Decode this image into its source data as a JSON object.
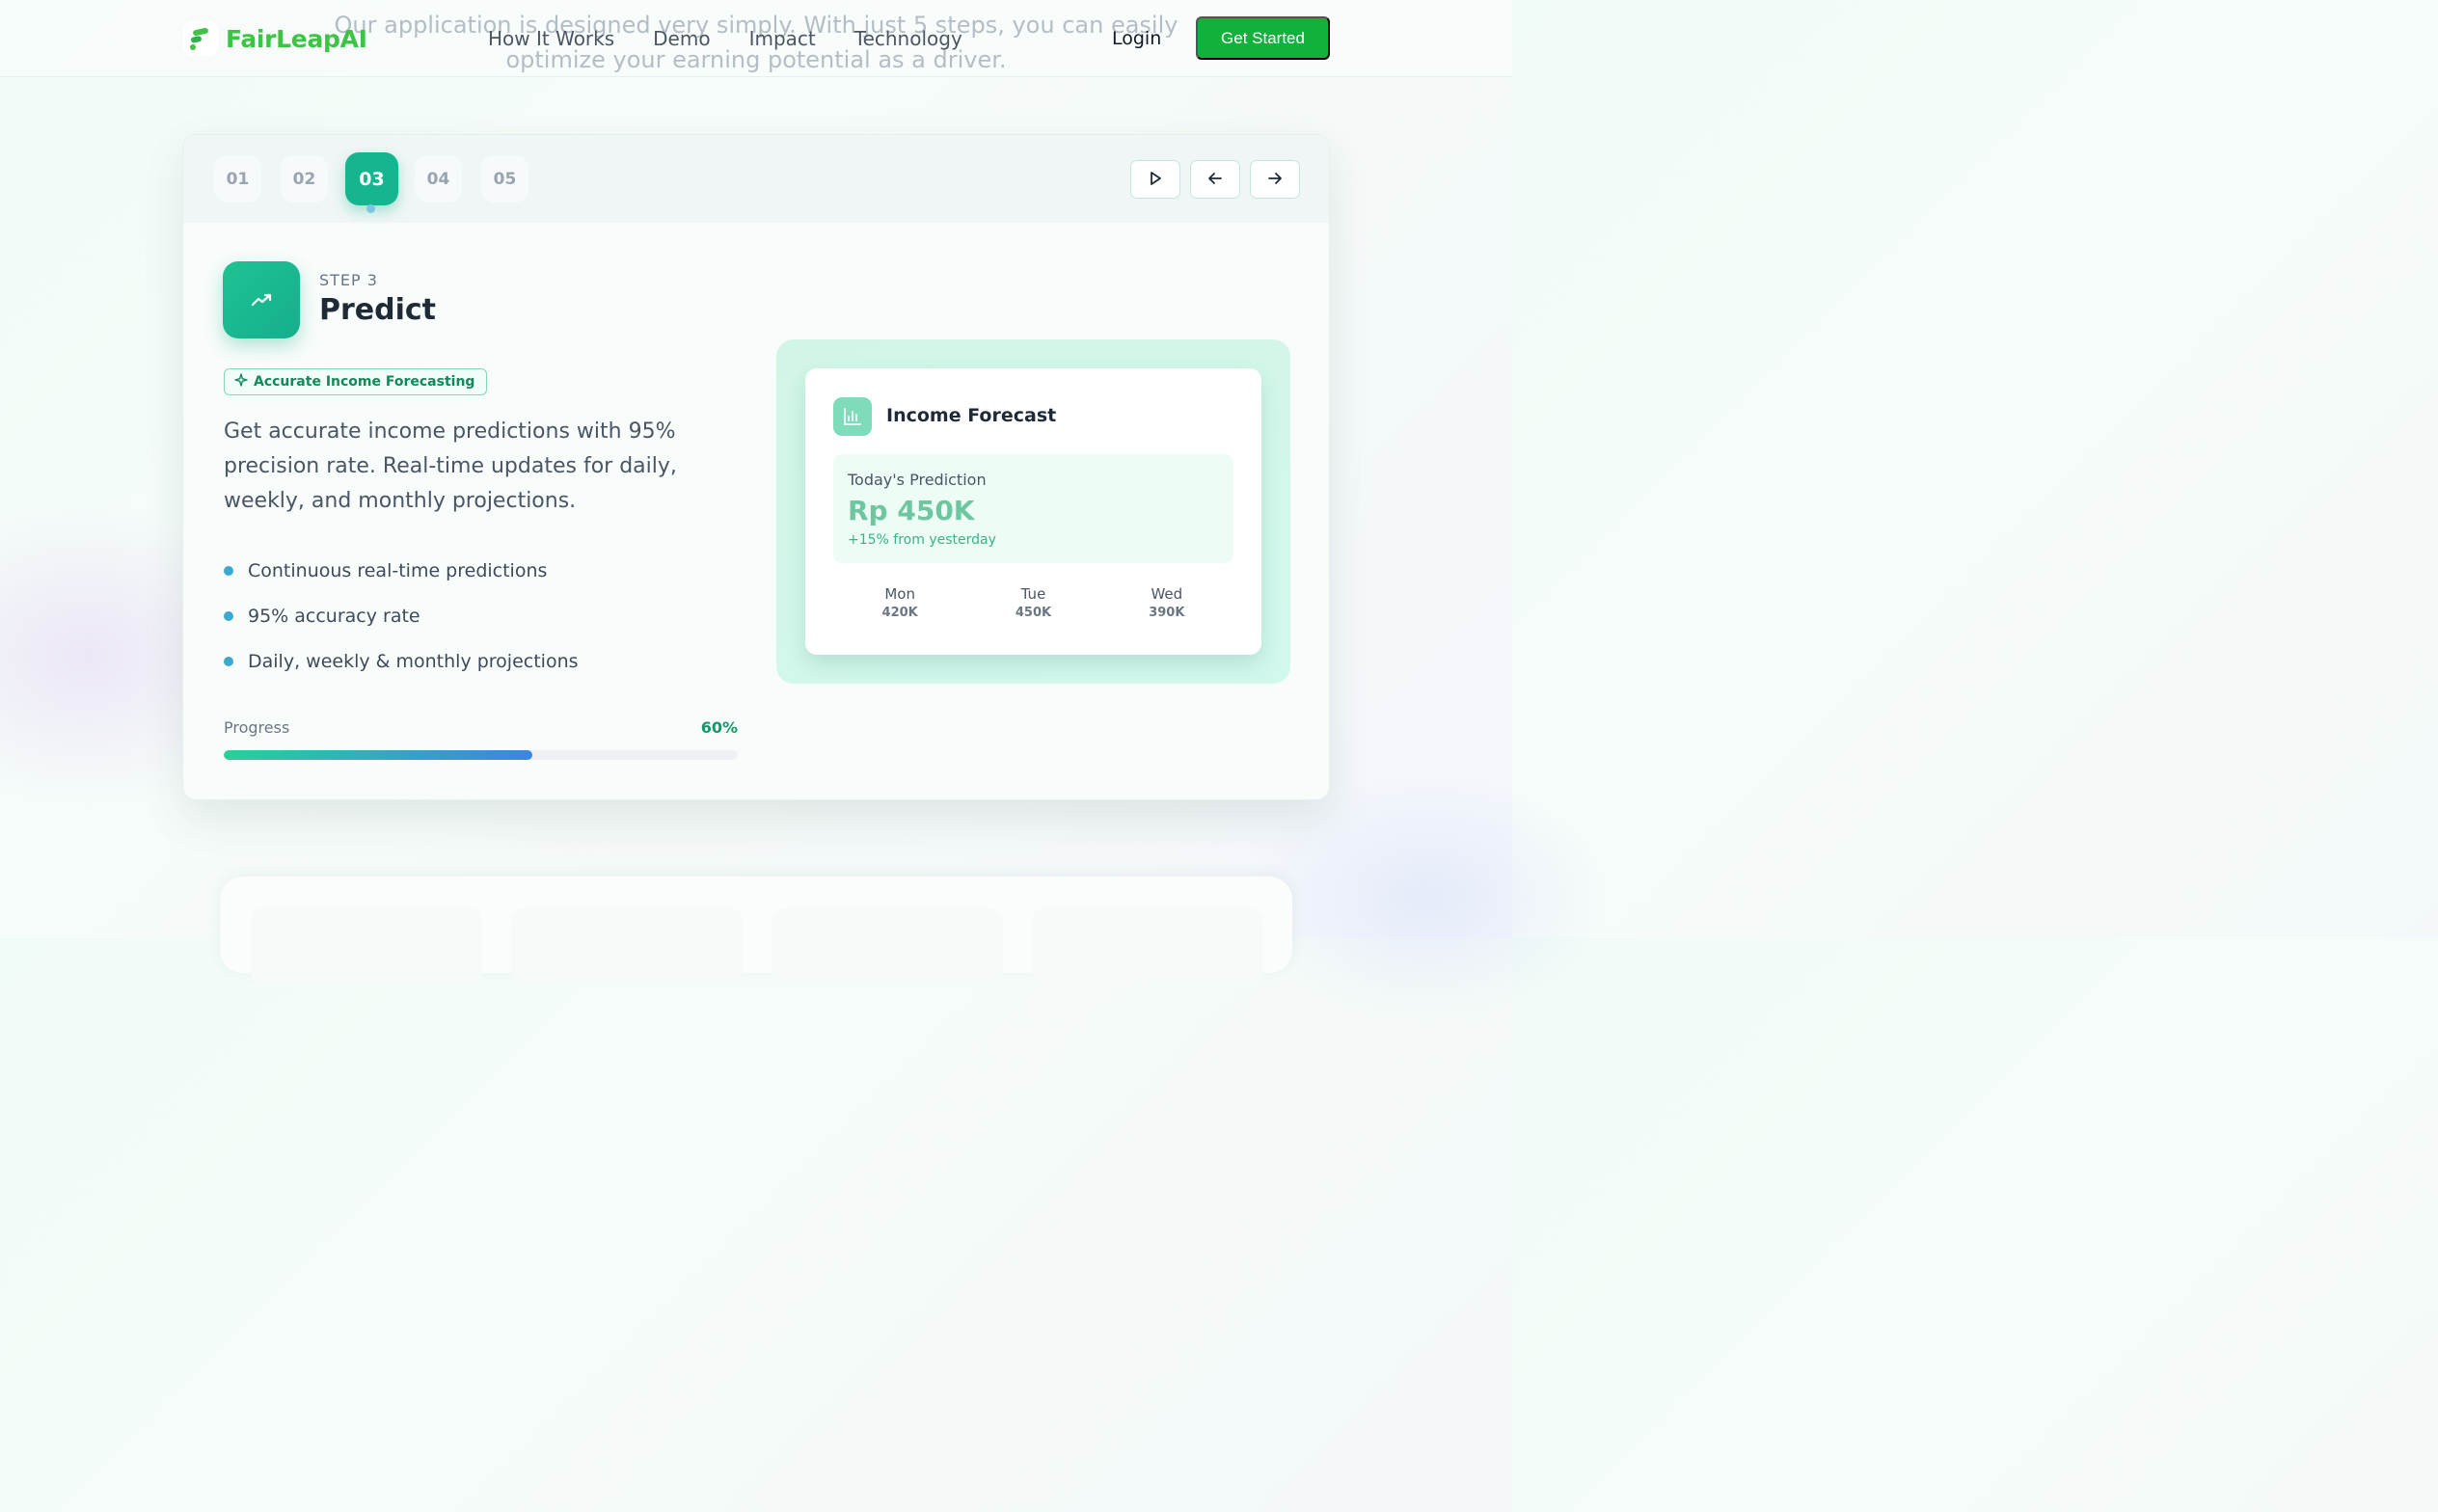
{
  "nav": {
    "brand": "FairLeapAI",
    "links": [
      "How It Works",
      "Demo",
      "Impact",
      "Technology"
    ],
    "login": "Login",
    "cta": "Get Started",
    "ghost_text": "Our application is designed very simply. With just 5 steps, you can easily optimize your earning potential as a driver."
  },
  "steps": {
    "items": [
      "01",
      "02",
      "03",
      "04",
      "05"
    ],
    "active_index": 2
  },
  "step_detail": {
    "label": "STEP 3",
    "title": "Predict",
    "badge": "Accurate Income Forecasting",
    "description": "Get accurate income predictions with 95% precision rate. Real-time updates for daily, weekly, and monthly projections.",
    "bullets": [
      "Continuous real-time predictions",
      "95% accuracy rate",
      "Daily, weekly & monthly projections"
    ],
    "progress_label": "Progress",
    "progress_value": "60%",
    "progress_fraction": 0.6
  },
  "forecast": {
    "title": "Income Forecast",
    "today_label": "Today's Prediction",
    "amount": "Rp 450K",
    "change": "+15% from yesterday",
    "days": [
      {
        "name": "Mon",
        "value": "420K"
      },
      {
        "name": "Tue",
        "value": "450K"
      },
      {
        "name": "Wed",
        "value": "390K"
      }
    ]
  },
  "colors": {
    "brand_green": "#3cc444",
    "cta_green": "#11b13c",
    "accent_teal": "#17b58f",
    "bullet_blue": "#3aa8cf"
  },
  "icons": {
    "brand": "leaf-logo-icon",
    "step": "trending-up-icon",
    "badge": "sparkle-icon",
    "forecast": "bar-chart-icon",
    "controls": [
      "play-icon",
      "arrow-left-icon",
      "arrow-right-icon"
    ]
  }
}
